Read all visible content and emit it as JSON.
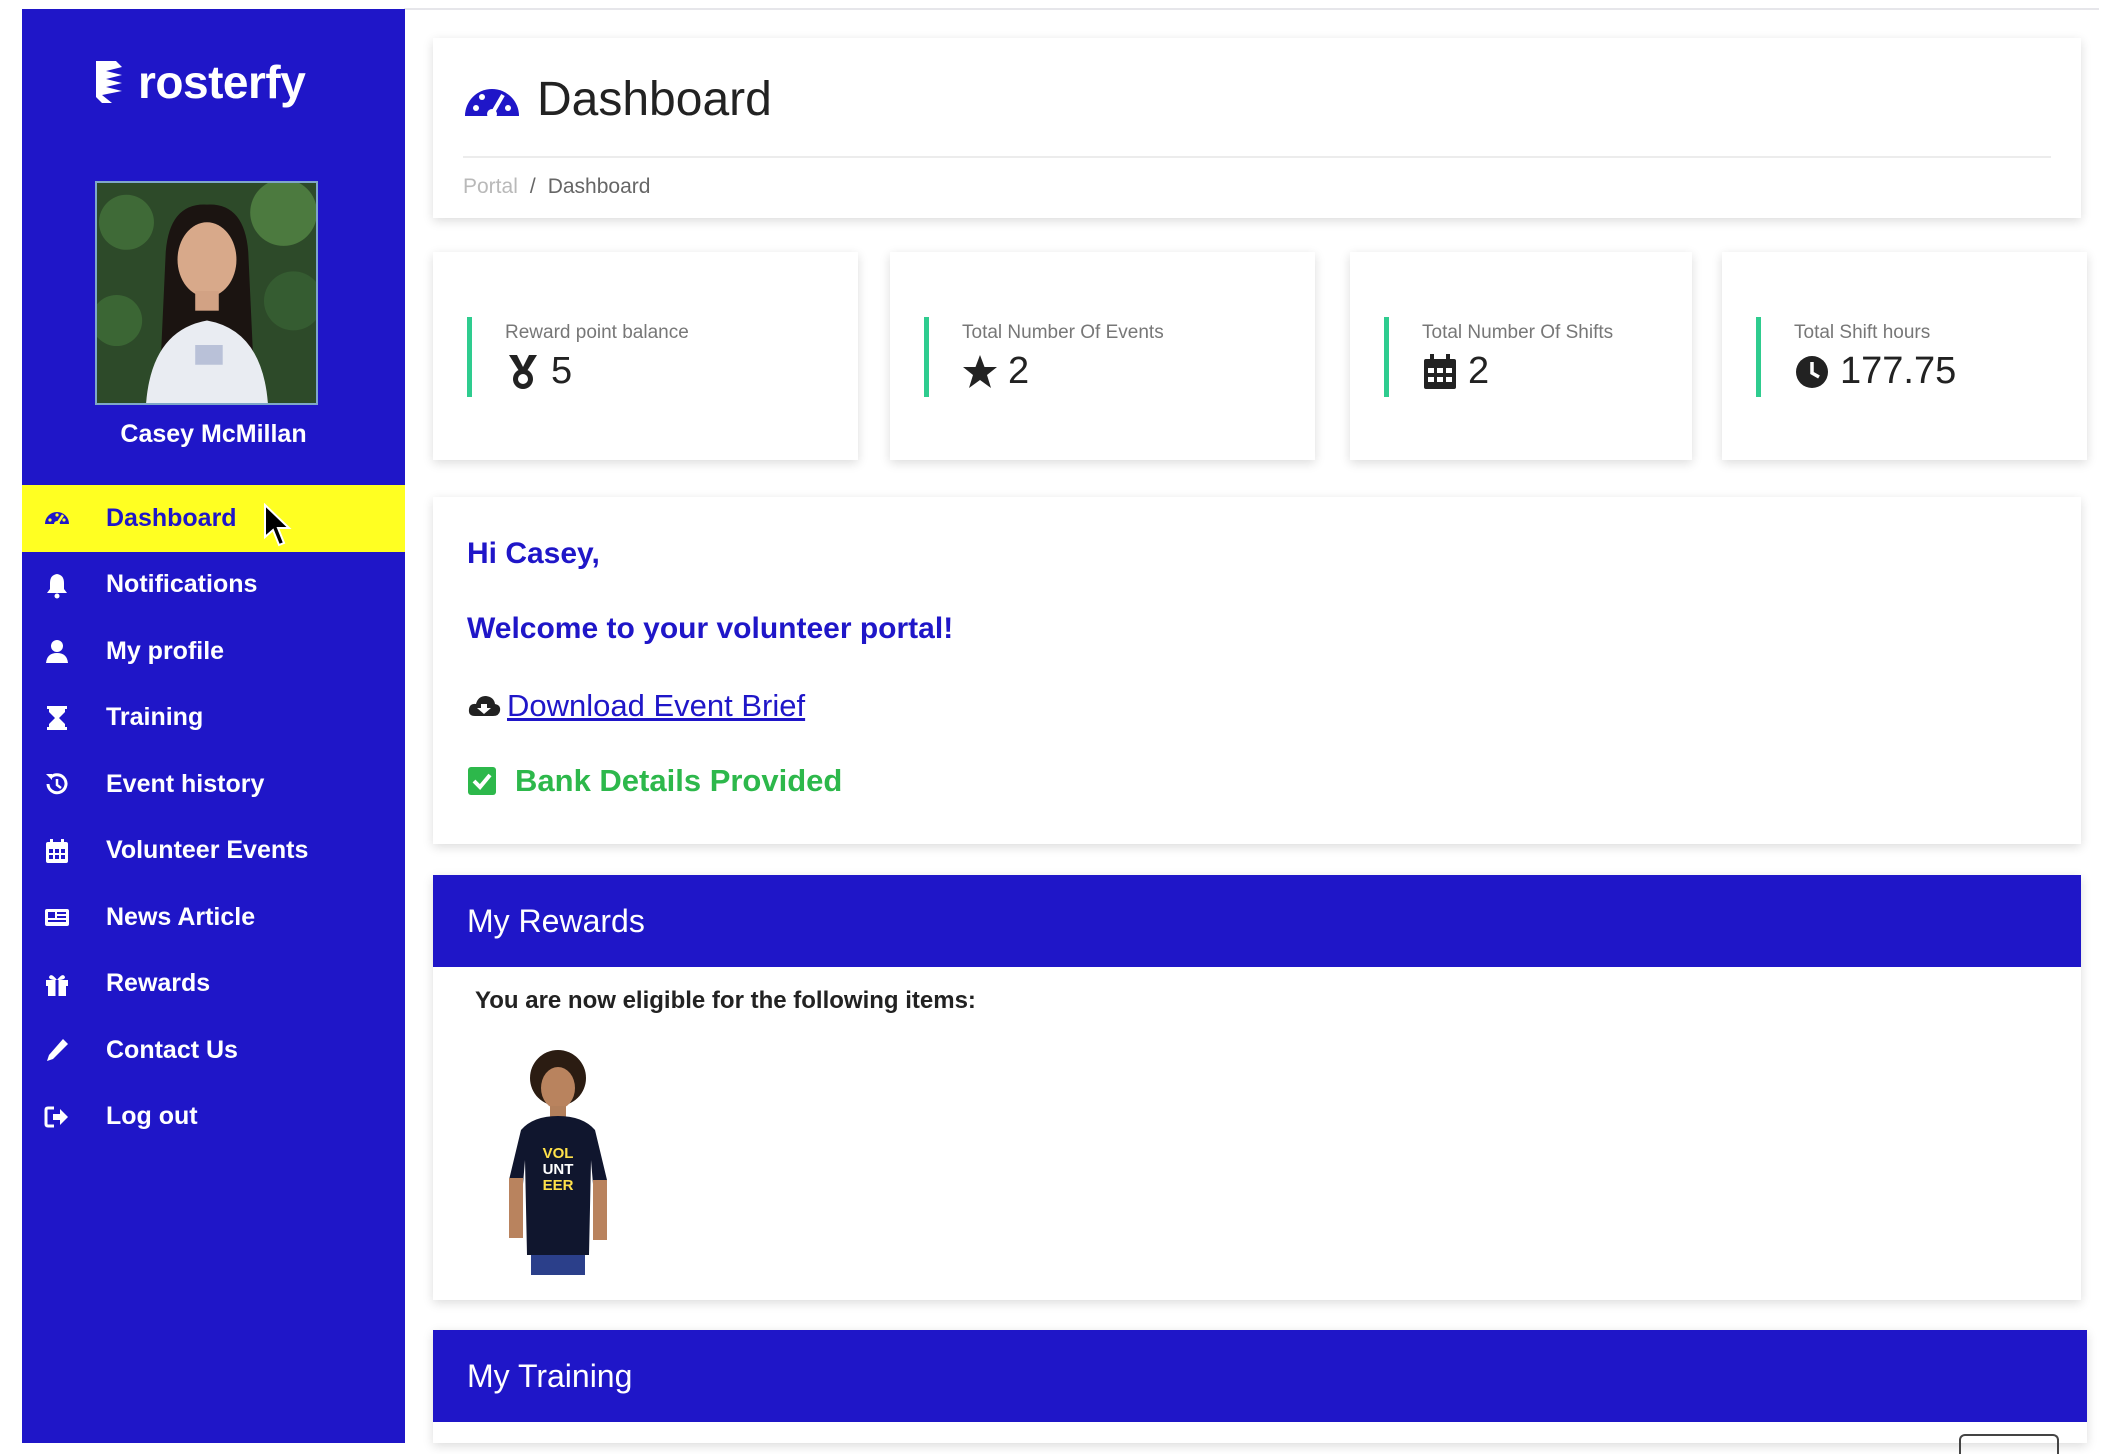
{
  "brand": {
    "name": "rosterfy"
  },
  "user": {
    "name": "Casey McMillan"
  },
  "nav": [
    {
      "label": "Dashboard",
      "icon": "dashboard-icon",
      "active": true
    },
    {
      "label": "Notifications",
      "icon": "bell-icon"
    },
    {
      "label": "My profile",
      "icon": "user-icon"
    },
    {
      "label": "Training",
      "icon": "hourglass-icon"
    },
    {
      "label": "Event history",
      "icon": "history-icon"
    },
    {
      "label": "Volunteer Events",
      "icon": "calendar-icon"
    },
    {
      "label": "News Article",
      "icon": "newspaper-icon"
    },
    {
      "label": "Rewards",
      "icon": "gift-icon"
    },
    {
      "label": "Contact Us",
      "icon": "pencil-icon"
    },
    {
      "label": "Log out",
      "icon": "sign-out-icon"
    }
  ],
  "header": {
    "title": "Dashboard",
    "breadcrumb": [
      "Portal",
      "/",
      "Dashboard"
    ]
  },
  "stats": [
    {
      "label": "Reward point balance",
      "value": "5",
      "icon": "medal-icon"
    },
    {
      "label": "Total Number Of Events",
      "value": "2",
      "icon": "star-icon"
    },
    {
      "label": "Total Number Of Shifts",
      "value": "2",
      "icon": "calendar-icon"
    },
    {
      "label": "Total Shift hours",
      "value": "177.75",
      "icon": "clock-icon"
    }
  ],
  "welcome": {
    "greeting": "Hi Casey,",
    "message": "Welcome to your volunteer portal!",
    "download_link": "Download Event Brief",
    "bank_status": "Bank Details Provided"
  },
  "rewards": {
    "title": "My Rewards",
    "eligible_text": "You are now eligible for the following items:",
    "items": [
      {
        "image": "volunteer-tshirt-photo",
        "shirt_text": "VOL UNT EER"
      }
    ]
  },
  "training": {
    "title": "My Training"
  },
  "colors": {
    "primary": "#1f16c8",
    "active_nav": "#ffff22",
    "accent_green": "#2ecc8f",
    "success": "#2db84b"
  }
}
